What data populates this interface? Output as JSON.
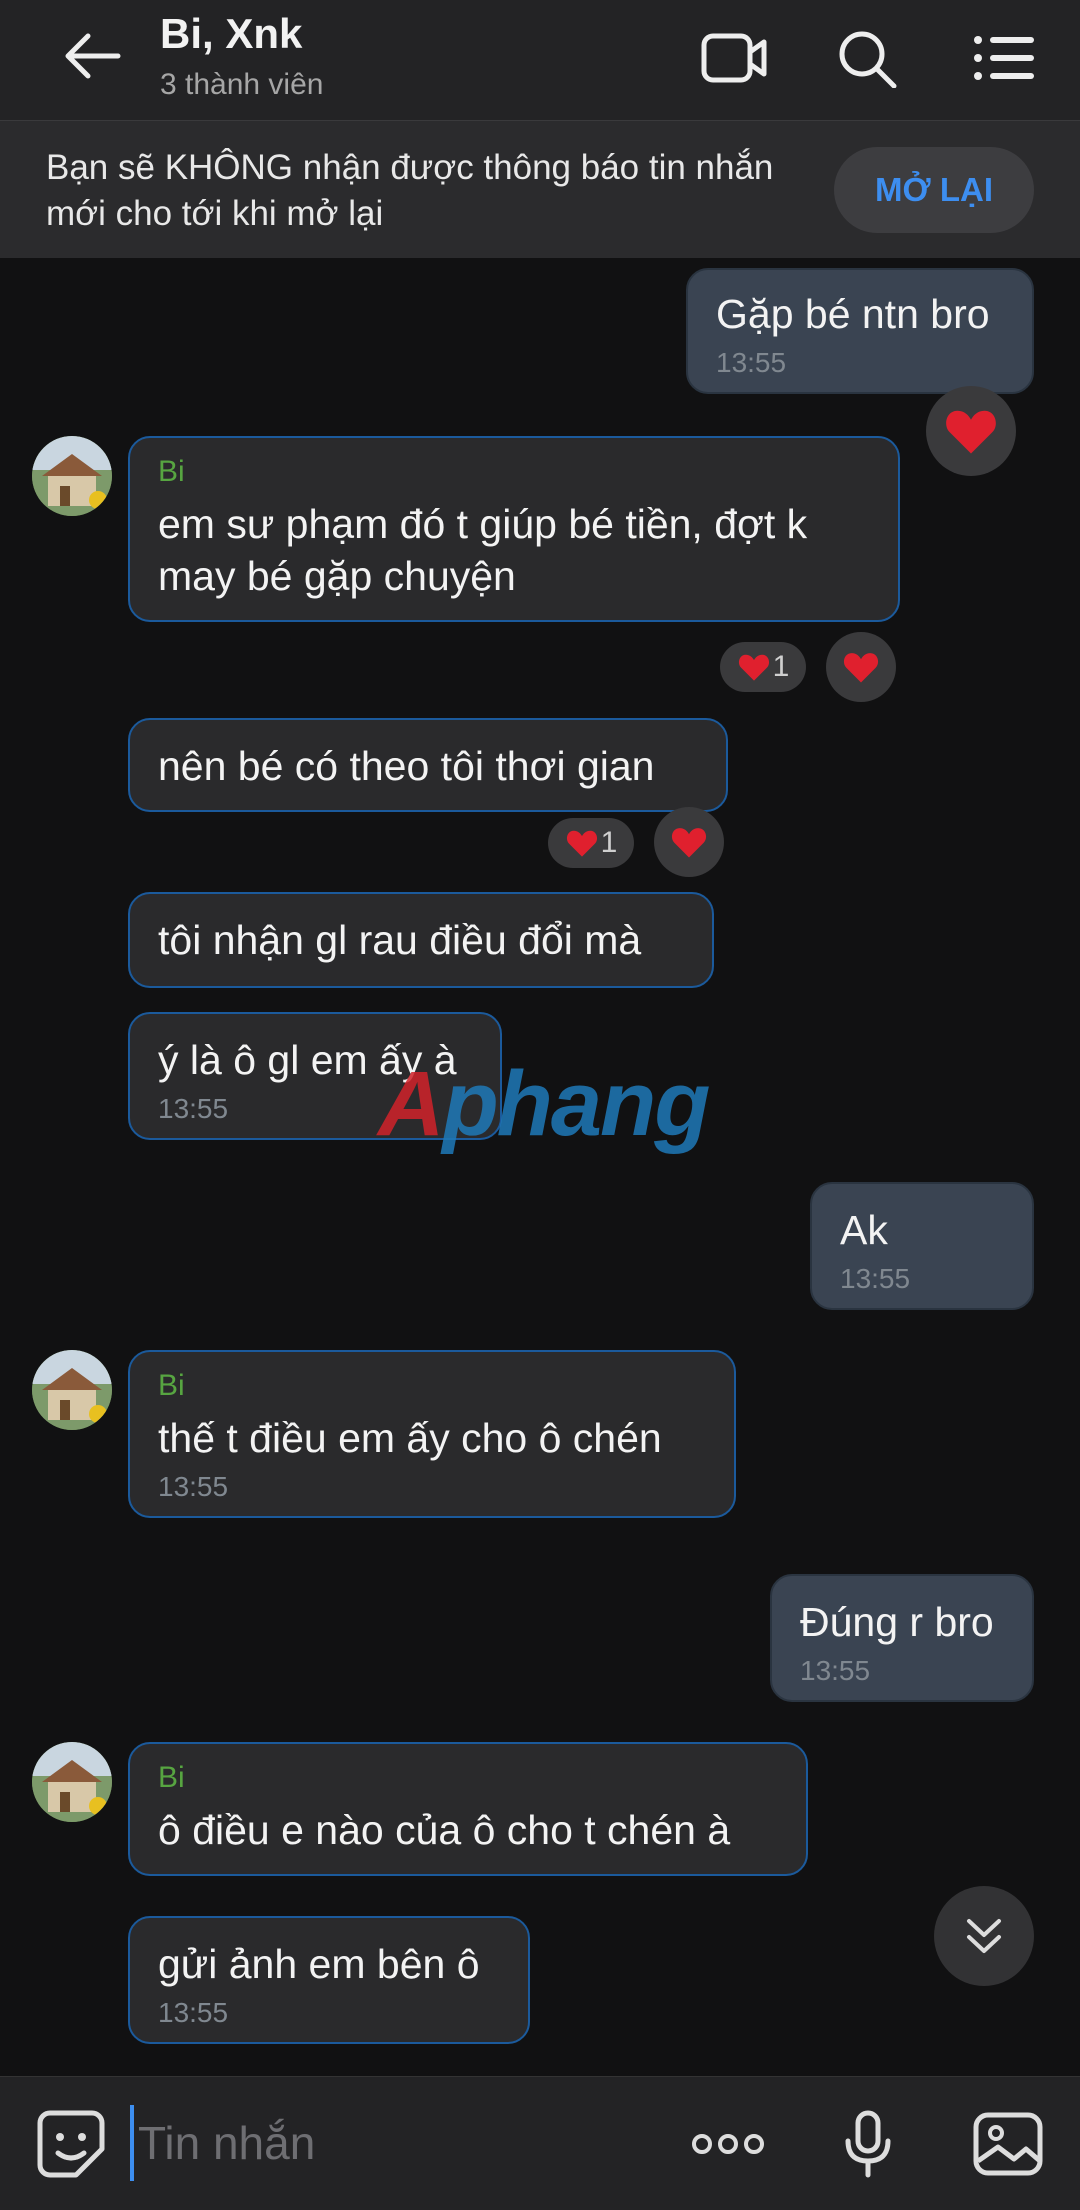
{
  "header": {
    "title": "Bi, Xnk",
    "subtitle": "3 thành viên",
    "icons": [
      "back-arrow-icon",
      "video-call-icon",
      "search-icon",
      "list-menu-icon"
    ]
  },
  "notice": {
    "text": "Bạn sẽ KHÔNG nhận được thông báo tin nhắn mới cho tới khi mở lại",
    "button": "MỞ LẠI"
  },
  "messages": [
    {
      "dir": "out",
      "text": "Gặp bé ntn bro",
      "time": "13:55",
      "reaction": "❤️"
    },
    {
      "dir": "in",
      "sender": "Bi",
      "text": "em sư phạm đó t giúp bé tiền, đợt k may bé gặp chuyện",
      "reactions_count": "1"
    },
    {
      "dir": "in",
      "text": "nên bé có theo tôi thơi gian",
      "reactions_count": "1"
    },
    {
      "dir": "in",
      "text": "tôi nhận gl rau điều đổi mà"
    },
    {
      "dir": "in",
      "text": "ý là ô gl em ấy à",
      "time": "13:55"
    },
    {
      "dir": "out",
      "text": "Ak",
      "time": "13:55"
    },
    {
      "dir": "in",
      "sender": "Bi",
      "text": "thế t điều em ấy cho ô chén",
      "time": "13:55"
    },
    {
      "dir": "out",
      "text": "Đúng r bro",
      "time": "13:55"
    },
    {
      "dir": "in",
      "sender": "Bi",
      "text": "ô điều e nào của ô cho t chén à"
    },
    {
      "dir": "in",
      "text": "gửi ảnh em bên ô",
      "time": "13:55"
    }
  ],
  "watermark": {
    "part1": "A",
    "part2": "phang"
  },
  "composer": {
    "placeholder": "Tin nhắn",
    "icons": [
      "sticker-icon",
      "more-options-icon",
      "microphone-icon",
      "image-gallery-icon"
    ]
  },
  "colors": {
    "background": "#111112",
    "incoming_border": "#1b5a9c",
    "outgoing_bubble": "#3a4452",
    "sender_name": "#57a541",
    "accent": "#3d8ef0",
    "heart": "#e0202e"
  }
}
